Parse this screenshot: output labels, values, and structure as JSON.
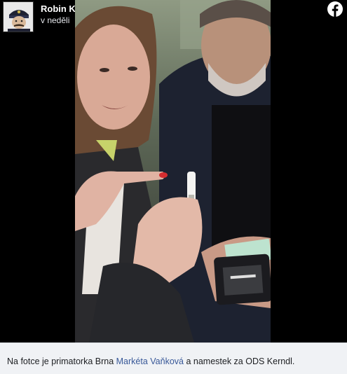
{
  "post": {
    "author": "Robin Kvapil",
    "time": "v neděli",
    "platform_icon": "facebook-icon"
  },
  "caption": {
    "before": "Na fotce je primatorka Brna ",
    "link": "Markéta Vaňková",
    "after": " a namestek za ODS Kerndl."
  },
  "colors": {
    "background": "#000000",
    "caption_bg": "#f0f2f5",
    "link": "#385898"
  }
}
